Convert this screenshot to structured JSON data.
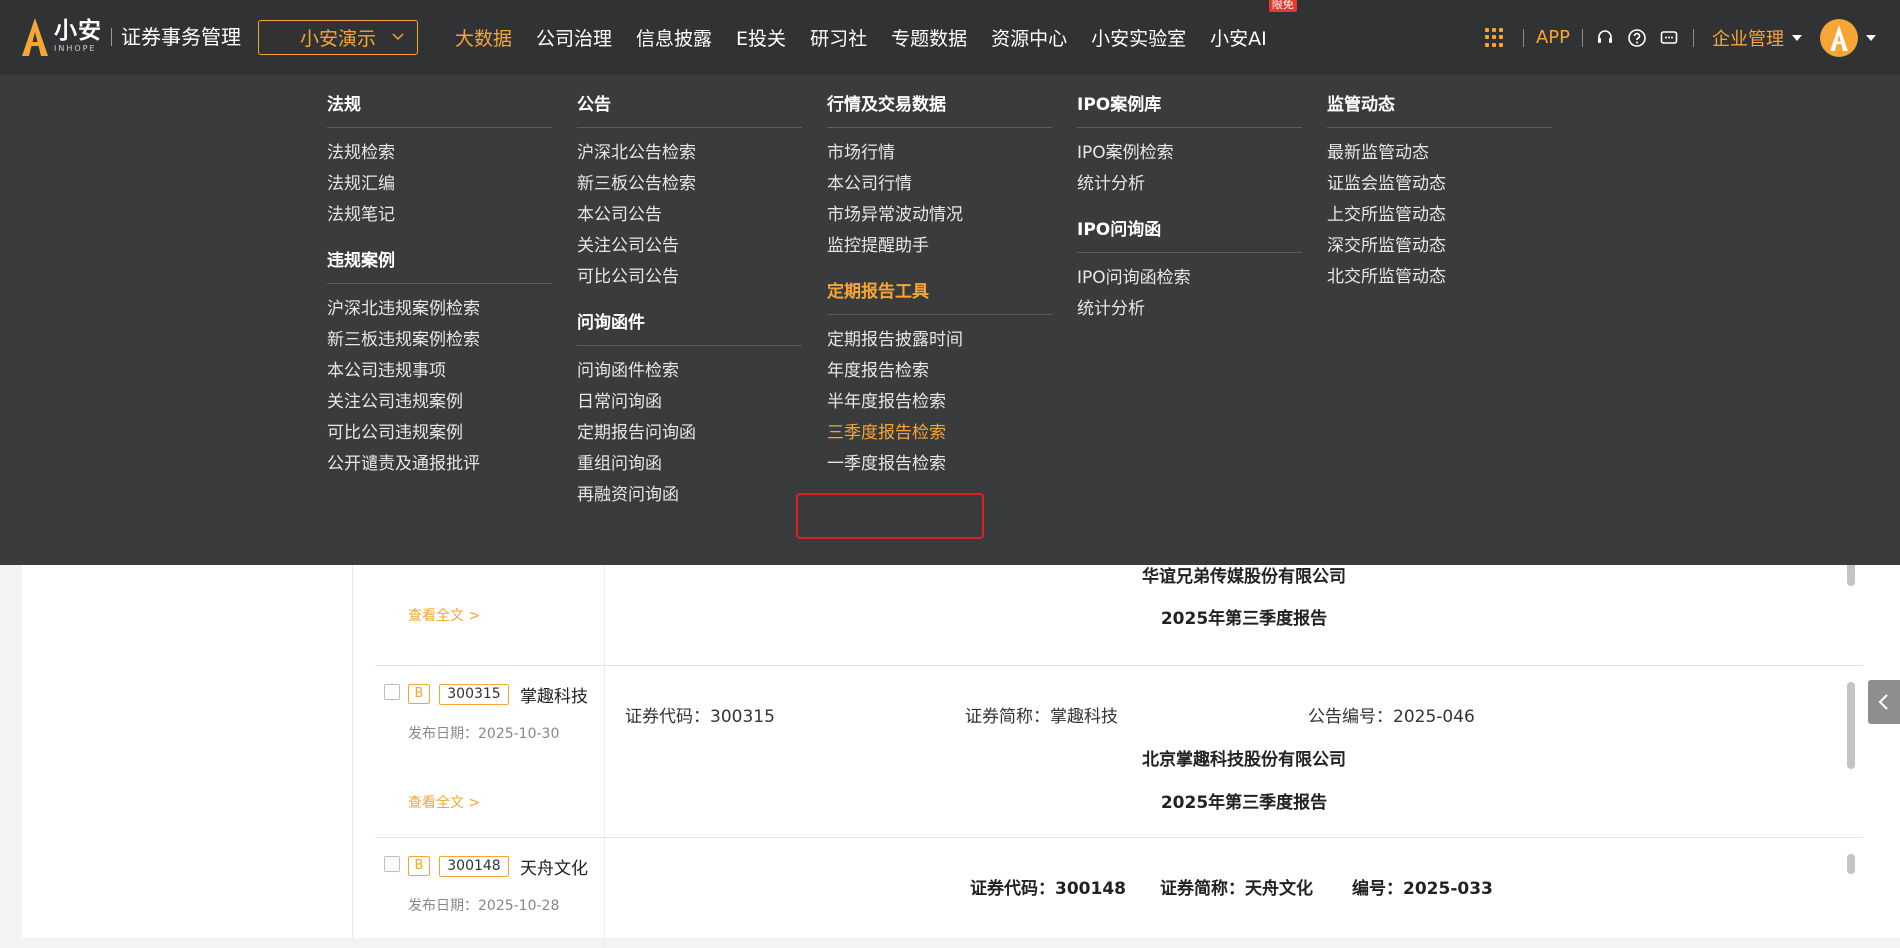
{
  "header": {
    "logo_cn": "小安",
    "logo_en": "INHOPE",
    "product_name": "证券事务管理",
    "company_select": "小安演示",
    "nav": [
      {
        "label": "大数据",
        "active": true
      },
      {
        "label": "公司治理",
        "active": false
      },
      {
        "label": "信息披露",
        "active": false
      },
      {
        "label": "E投关",
        "active": false
      },
      {
        "label": "研习社",
        "active": false
      },
      {
        "label": "专题数据",
        "active": false
      },
      {
        "label": "资源中心",
        "active": false
      },
      {
        "label": "小安实验室",
        "active": false
      },
      {
        "label": "小安AI",
        "active": false,
        "badge": "限免"
      }
    ],
    "app_label": "APP",
    "org_menu": "企业管理",
    "accent_color": "#f7a535"
  },
  "mega_menu": {
    "columns": [
      {
        "groups": [
          {
            "title": "法规",
            "items": [
              "法规检索",
              "法规汇编",
              "法规笔记"
            ]
          },
          {
            "title": "违规案例",
            "items": [
              "沪深北违规案例检索",
              "新三板违规案例检索",
              "本公司违规事项",
              "关注公司违规案例",
              "可比公司违规案例",
              "公开谴责及通报批评"
            ]
          }
        ]
      },
      {
        "groups": [
          {
            "title": "公告",
            "items": [
              "沪深北公告检索",
              "新三板公告检索",
              "本公司公告",
              "关注公司公告",
              "可比公司公告"
            ]
          },
          {
            "title": "问询函件",
            "items": [
              "问询函件检索",
              "日常问询函",
              "定期报告问询函",
              "重组问询函",
              "再融资问询函"
            ]
          }
        ]
      },
      {
        "groups": [
          {
            "title": "行情及交易数据",
            "items": [
              "市场行情",
              "本公司行情",
              "市场异常波动情况",
              "监控提醒助手"
            ]
          },
          {
            "title": "定期报告工具",
            "items": [
              "定期报告披露时间",
              "年度报告检索",
              "半年度报告检索",
              "三季度报告检索",
              "一季度报告检索"
            ],
            "active_title": true,
            "active_item": "三季度报告检索"
          }
        ]
      },
      {
        "groups": [
          {
            "title": "IPO案例库",
            "items": [
              "IPO案例检索",
              "统计分析"
            ]
          },
          {
            "title": "IPO问询函",
            "items": [
              "IPO问询函检索",
              "统计分析"
            ]
          }
        ]
      },
      {
        "groups": [
          {
            "title": "监管动态",
            "items": [
              "最新监管动态",
              "证监会监管动态",
              "上交所监管动态",
              "深交所监管动态",
              "北交所监管动态"
            ]
          }
        ]
      }
    ]
  },
  "results": [
    {
      "view_full": "查看全文 >",
      "company_full": "华谊兄弟传媒股份有限公司",
      "report_title": "2025年第三季度报告"
    },
    {
      "tag": "B",
      "code": "300315",
      "short_name": "掌趣科技",
      "publish_date": "发布日期：2025-10-30",
      "view_full": "查看全文 >",
      "kv": [
        "证券代码：300315",
        "证券简称：掌趣科技",
        "公告编号：2025-046"
      ],
      "company_full": "北京掌趣科技股份有限公司",
      "report_title": "2025年第三季度报告"
    },
    {
      "tag": "B",
      "code": "300148",
      "short_name": "天舟文化",
      "publish_date": "发布日期：2025-10-28",
      "kv": [
        "证券代码：300148",
        "证券简称：天舟文化",
        "编号：2025-033"
      ]
    }
  ]
}
